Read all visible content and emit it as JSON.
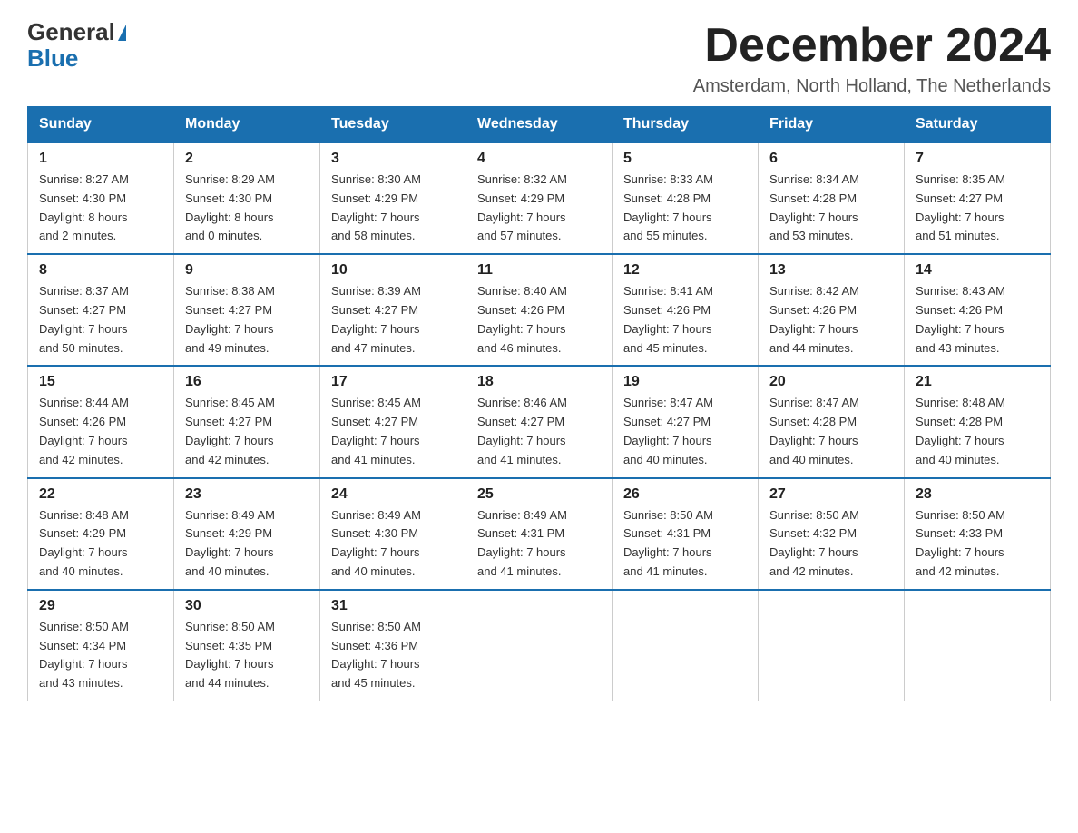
{
  "header": {
    "logo_general": "General",
    "logo_blue": "Blue",
    "month_title": "December 2024",
    "subtitle": "Amsterdam, North Holland, The Netherlands"
  },
  "days_of_week": [
    "Sunday",
    "Monday",
    "Tuesday",
    "Wednesday",
    "Thursday",
    "Friday",
    "Saturday"
  ],
  "weeks": [
    [
      {
        "day": "1",
        "sunrise": "Sunrise: 8:27 AM",
        "sunset": "Sunset: 4:30 PM",
        "daylight": "Daylight: 8 hours",
        "daylight2": "and 2 minutes."
      },
      {
        "day": "2",
        "sunrise": "Sunrise: 8:29 AM",
        "sunset": "Sunset: 4:30 PM",
        "daylight": "Daylight: 8 hours",
        "daylight2": "and 0 minutes."
      },
      {
        "day": "3",
        "sunrise": "Sunrise: 8:30 AM",
        "sunset": "Sunset: 4:29 PM",
        "daylight": "Daylight: 7 hours",
        "daylight2": "and 58 minutes."
      },
      {
        "day": "4",
        "sunrise": "Sunrise: 8:32 AM",
        "sunset": "Sunset: 4:29 PM",
        "daylight": "Daylight: 7 hours",
        "daylight2": "and 57 minutes."
      },
      {
        "day": "5",
        "sunrise": "Sunrise: 8:33 AM",
        "sunset": "Sunset: 4:28 PM",
        "daylight": "Daylight: 7 hours",
        "daylight2": "and 55 minutes."
      },
      {
        "day": "6",
        "sunrise": "Sunrise: 8:34 AM",
        "sunset": "Sunset: 4:28 PM",
        "daylight": "Daylight: 7 hours",
        "daylight2": "and 53 minutes."
      },
      {
        "day": "7",
        "sunrise": "Sunrise: 8:35 AM",
        "sunset": "Sunset: 4:27 PM",
        "daylight": "Daylight: 7 hours",
        "daylight2": "and 51 minutes."
      }
    ],
    [
      {
        "day": "8",
        "sunrise": "Sunrise: 8:37 AM",
        "sunset": "Sunset: 4:27 PM",
        "daylight": "Daylight: 7 hours",
        "daylight2": "and 50 minutes."
      },
      {
        "day": "9",
        "sunrise": "Sunrise: 8:38 AM",
        "sunset": "Sunset: 4:27 PM",
        "daylight": "Daylight: 7 hours",
        "daylight2": "and 49 minutes."
      },
      {
        "day": "10",
        "sunrise": "Sunrise: 8:39 AM",
        "sunset": "Sunset: 4:27 PM",
        "daylight": "Daylight: 7 hours",
        "daylight2": "and 47 minutes."
      },
      {
        "day": "11",
        "sunrise": "Sunrise: 8:40 AM",
        "sunset": "Sunset: 4:26 PM",
        "daylight": "Daylight: 7 hours",
        "daylight2": "and 46 minutes."
      },
      {
        "day": "12",
        "sunrise": "Sunrise: 8:41 AM",
        "sunset": "Sunset: 4:26 PM",
        "daylight": "Daylight: 7 hours",
        "daylight2": "and 45 minutes."
      },
      {
        "day": "13",
        "sunrise": "Sunrise: 8:42 AM",
        "sunset": "Sunset: 4:26 PM",
        "daylight": "Daylight: 7 hours",
        "daylight2": "and 44 minutes."
      },
      {
        "day": "14",
        "sunrise": "Sunrise: 8:43 AM",
        "sunset": "Sunset: 4:26 PM",
        "daylight": "Daylight: 7 hours",
        "daylight2": "and 43 minutes."
      }
    ],
    [
      {
        "day": "15",
        "sunrise": "Sunrise: 8:44 AM",
        "sunset": "Sunset: 4:26 PM",
        "daylight": "Daylight: 7 hours",
        "daylight2": "and 42 minutes."
      },
      {
        "day": "16",
        "sunrise": "Sunrise: 8:45 AM",
        "sunset": "Sunset: 4:27 PM",
        "daylight": "Daylight: 7 hours",
        "daylight2": "and 42 minutes."
      },
      {
        "day": "17",
        "sunrise": "Sunrise: 8:45 AM",
        "sunset": "Sunset: 4:27 PM",
        "daylight": "Daylight: 7 hours",
        "daylight2": "and 41 minutes."
      },
      {
        "day": "18",
        "sunrise": "Sunrise: 8:46 AM",
        "sunset": "Sunset: 4:27 PM",
        "daylight": "Daylight: 7 hours",
        "daylight2": "and 41 minutes."
      },
      {
        "day": "19",
        "sunrise": "Sunrise: 8:47 AM",
        "sunset": "Sunset: 4:27 PM",
        "daylight": "Daylight: 7 hours",
        "daylight2": "and 40 minutes."
      },
      {
        "day": "20",
        "sunrise": "Sunrise: 8:47 AM",
        "sunset": "Sunset: 4:28 PM",
        "daylight": "Daylight: 7 hours",
        "daylight2": "and 40 minutes."
      },
      {
        "day": "21",
        "sunrise": "Sunrise: 8:48 AM",
        "sunset": "Sunset: 4:28 PM",
        "daylight": "Daylight: 7 hours",
        "daylight2": "and 40 minutes."
      }
    ],
    [
      {
        "day": "22",
        "sunrise": "Sunrise: 8:48 AM",
        "sunset": "Sunset: 4:29 PM",
        "daylight": "Daylight: 7 hours",
        "daylight2": "and 40 minutes."
      },
      {
        "day": "23",
        "sunrise": "Sunrise: 8:49 AM",
        "sunset": "Sunset: 4:29 PM",
        "daylight": "Daylight: 7 hours",
        "daylight2": "and 40 minutes."
      },
      {
        "day": "24",
        "sunrise": "Sunrise: 8:49 AM",
        "sunset": "Sunset: 4:30 PM",
        "daylight": "Daylight: 7 hours",
        "daylight2": "and 40 minutes."
      },
      {
        "day": "25",
        "sunrise": "Sunrise: 8:49 AM",
        "sunset": "Sunset: 4:31 PM",
        "daylight": "Daylight: 7 hours",
        "daylight2": "and 41 minutes."
      },
      {
        "day": "26",
        "sunrise": "Sunrise: 8:50 AM",
        "sunset": "Sunset: 4:31 PM",
        "daylight": "Daylight: 7 hours",
        "daylight2": "and 41 minutes."
      },
      {
        "day": "27",
        "sunrise": "Sunrise: 8:50 AM",
        "sunset": "Sunset: 4:32 PM",
        "daylight": "Daylight: 7 hours",
        "daylight2": "and 42 minutes."
      },
      {
        "day": "28",
        "sunrise": "Sunrise: 8:50 AM",
        "sunset": "Sunset: 4:33 PM",
        "daylight": "Daylight: 7 hours",
        "daylight2": "and 42 minutes."
      }
    ],
    [
      {
        "day": "29",
        "sunrise": "Sunrise: 8:50 AM",
        "sunset": "Sunset: 4:34 PM",
        "daylight": "Daylight: 7 hours",
        "daylight2": "and 43 minutes."
      },
      {
        "day": "30",
        "sunrise": "Sunrise: 8:50 AM",
        "sunset": "Sunset: 4:35 PM",
        "daylight": "Daylight: 7 hours",
        "daylight2": "and 44 minutes."
      },
      {
        "day": "31",
        "sunrise": "Sunrise: 8:50 AM",
        "sunset": "Sunset: 4:36 PM",
        "daylight": "Daylight: 7 hours",
        "daylight2": "and 45 minutes."
      },
      {
        "day": "",
        "sunrise": "",
        "sunset": "",
        "daylight": "",
        "daylight2": ""
      },
      {
        "day": "",
        "sunrise": "",
        "sunset": "",
        "daylight": "",
        "daylight2": ""
      },
      {
        "day": "",
        "sunrise": "",
        "sunset": "",
        "daylight": "",
        "daylight2": ""
      },
      {
        "day": "",
        "sunrise": "",
        "sunset": "",
        "daylight": "",
        "daylight2": ""
      }
    ]
  ],
  "colors": {
    "header_bg": "#1a6faf",
    "header_text": "#ffffff",
    "border": "#1a6faf",
    "cell_text": "#333333",
    "title_color": "#222222"
  }
}
